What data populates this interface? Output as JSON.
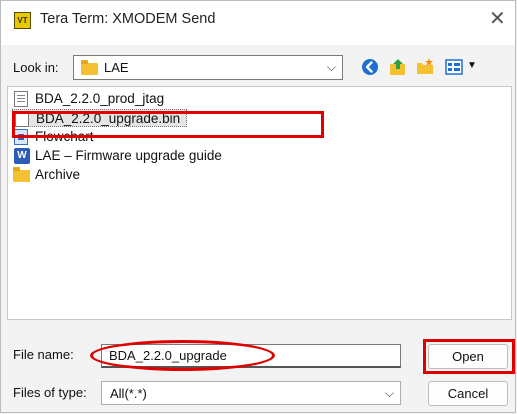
{
  "window": {
    "title": "Tera Term: XMODEM Send",
    "app_icon_text": "VT",
    "close_glyph": "✕"
  },
  "lookin": {
    "label": "Look in:",
    "value": "LAE"
  },
  "toolbar": {
    "icons": [
      "back-icon",
      "up-folder-icon",
      "new-folder-icon",
      "view-menu-icon"
    ]
  },
  "files": [
    {
      "name": "BDA_2.2.0_prod_jtag",
      "icon": "text-file-icon"
    },
    {
      "name": "BDA_2.2.0_upgrade.bin",
      "icon": "file-icon",
      "selected": true
    },
    {
      "name": "Flowchart",
      "icon": "flowchart-file-icon"
    },
    {
      "name": "LAE – Firmware upgrade guide",
      "icon": "word-document-icon"
    },
    {
      "name": "Archive",
      "icon": "folder-icon"
    }
  ],
  "filename": {
    "label": "File name:",
    "value": "BDA_2.2.0_upgrade"
  },
  "filetype": {
    "label": "Files of type:",
    "value": "All(*.*)"
  },
  "buttons": {
    "open": "Open",
    "cancel": "Cancel"
  },
  "colors": {
    "annotation": "#e00000",
    "folder": "#f5c132",
    "selection": "#e5e5e5"
  }
}
